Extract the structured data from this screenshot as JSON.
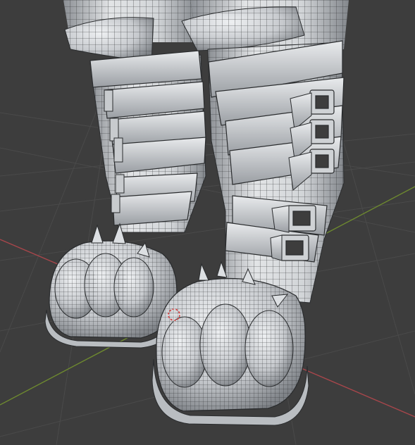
{
  "viewport": {
    "background_color": "#3d3d3d",
    "grid_line_color": "#4a4a4a",
    "x_axis_color": "#a8464b",
    "y_axis_color": "#6e8a2f",
    "mesh_fill_light": "#e6e8ea",
    "mesh_fill_mid": "#b9bdc1",
    "mesh_fill_dark": "#7d8186",
    "wire_color": "#2a2c2e",
    "origin_marker_color": "#d33a3a",
    "origin_marker_icon": "3d-cursor-icon",
    "subject": "wireframe-mesh-paw-boots"
  }
}
